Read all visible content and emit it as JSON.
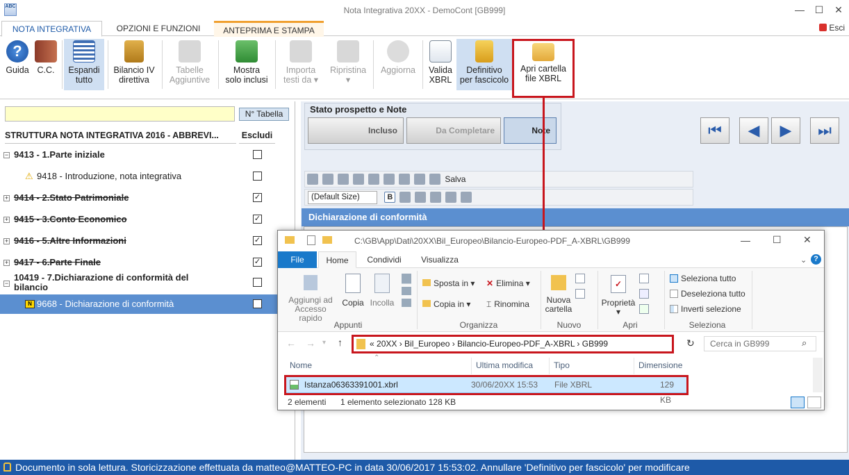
{
  "window": {
    "title": "Nota Integrativa 20XX - DemoCont [GB999]",
    "app_icon": "ABC"
  },
  "tabs": [
    "NOTA INTEGRATIVA",
    "OPZIONI E FUNZIONI",
    "ANTEPRIMA E STAMPA"
  ],
  "esci": "Esci",
  "ribbon": {
    "guida": "Guida",
    "cc": "C.C.",
    "espandi": [
      "Espandi",
      "tutto"
    ],
    "bilancio": [
      "Bilancio IV",
      "direttiva"
    ],
    "tabelle": [
      "Tabelle",
      "Aggiuntive"
    ],
    "mostra": [
      "Mostra",
      "solo inclusi"
    ],
    "importa": [
      "Importa",
      "testi da"
    ],
    "ripristina": "Ripristina",
    "aggiorna": "Aggiorna",
    "valida": [
      "Valida",
      "XBRL"
    ],
    "definitivo": [
      "Definitivo",
      "per fascicolo"
    ],
    "apri": [
      "Apri cartella",
      "file XBRL"
    ]
  },
  "left": {
    "search_value": "",
    "ntab_button": "N° Tabella",
    "header_title": "STRUTTURA NOTA INTEGRATIVA 2016 - ABBREVI...",
    "header_escludi": "Escludi",
    "rows": [
      {
        "label": "9413 - 1.Parte iniziale",
        "checked": "",
        "bold": true
      },
      {
        "label": "9418 - Introduzione, nota integrativa",
        "checked": "",
        "bold": false
      },
      {
        "label": "9414 - 2.Stato Patrimoniale",
        "checked": "✓",
        "bold": true
      },
      {
        "label": "9415 - 3.Conto Economico",
        "checked": "✓",
        "bold": true
      },
      {
        "label": "9416 - 5.Altre Informazioni",
        "checked": "✓",
        "bold": true
      },
      {
        "label": "9417 - 6.Parte Finale",
        "checked": "✓",
        "bold": true
      },
      {
        "label1": "10419 - 7.Dichiarazione di conformità del",
        "label2": "bilancio",
        "checked": ""
      },
      {
        "label": "9668 - Dichiarazione di conformità",
        "checked": ""
      }
    ]
  },
  "status_group": {
    "title": "Stato prospetto e Note",
    "incluso": "Incluso",
    "da_completare": "Da Completare",
    "note": "Note"
  },
  "editor_toolbar": {
    "salva": "Salva",
    "font_size": "(Default Size)"
  },
  "section_title": "Dichiarazione di conformità",
  "explorer": {
    "path": "C:\\GB\\App\\Dati\\20XX\\Bil_Europeo\\Bilancio-Europeo-PDF_A-XBRL\\GB999",
    "tabs": [
      "File",
      "Home",
      "Condividi",
      "Visualizza"
    ],
    "clipboard": {
      "pin": [
        "Aggiungi ad",
        "Accesso rapido"
      ],
      "copia": "Copia",
      "incolla": "Incolla",
      "group": "Appunti"
    },
    "organize": {
      "sposta": "Sposta in",
      "copia_in": "Copia in",
      "elimina": "Elimina",
      "rinomina": "Rinomina",
      "group": "Organizza"
    },
    "new": {
      "nuova": [
        "Nuova",
        "cartella"
      ],
      "group": "Nuovo"
    },
    "open": {
      "proprieta": "Proprietà",
      "group": "Apri"
    },
    "select": {
      "tutto": "Seleziona tutto",
      "desel": "Deseleziona tutto",
      "inverti": "Inverti selezione",
      "group": "Seleziona"
    },
    "breadcrumb": [
      "20XX",
      "Bil_Europeo",
      "Bilancio-Europeo-PDF_A-XBRL",
      "GB999"
    ],
    "search_placeholder": "Cerca in GB999",
    "columns": [
      "Nome",
      "Ultima modifica",
      "Tipo",
      "Dimensione"
    ],
    "file": {
      "name": "Istanza06363391001.xbrl",
      "date": "30/06/20XX 15:53",
      "type": "File XBRL",
      "size": "129 KB"
    },
    "status_count": "2 elementi",
    "status_sel": "1 elemento selezionato  128 KB"
  },
  "statusbar": "Documento in sola lettura. Storicizzazione effettuata da matteo@MATTEO-PC in data 30/06/2017 15:53:02. Annullare 'Definitivo per fascicolo' per modificare"
}
